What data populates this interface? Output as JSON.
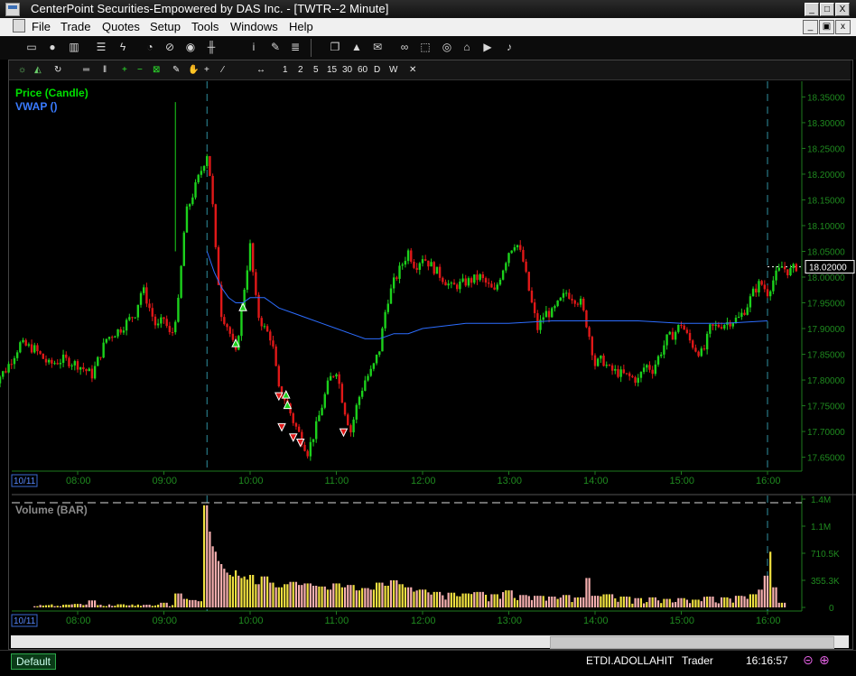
{
  "window": {
    "title": "CenterPoint Securities-Empowered by DAS Inc. - [TWTR--2 Minute]",
    "controls": [
      "_",
      "□",
      "X"
    ]
  },
  "menu": {
    "items": [
      "File",
      "Trade",
      "Quotes",
      "Setup",
      "Tools",
      "Windows",
      "Help"
    ],
    "mdi_controls": [
      "_",
      "▣",
      "x"
    ]
  },
  "toolbar": {
    "icons": [
      "window-icon",
      "person-icon",
      "chart-icon",
      "list-icon",
      "lightning-icon",
      "clock-icon",
      "link-icon",
      "eye-icon",
      "candles-icon",
      "info-icon",
      "edit-icon",
      "multi-window-icon",
      "alert-icon",
      "mail-icon",
      "binoculars-icon",
      "dotted-box-icon",
      "home-icon",
      "play-icon",
      "twitter-icon"
    ]
  },
  "chart_toolbar": {
    "timeframes": [
      "1",
      "2",
      "5",
      "15",
      "30",
      "60",
      "D",
      "W"
    ]
  },
  "chart_data": {
    "type": "candlestick",
    "symbol": "TWTR",
    "interval": "2 Minute",
    "indicators": [
      {
        "name": "Price (Candle)",
        "color": "#00e000"
      },
      {
        "name": "VWAP ()",
        "color": "#2c6dff"
      }
    ],
    "price_axis": {
      "ticks": [
        "18.35000",
        "18.30000",
        "18.25000",
        "18.20000",
        "18.15000",
        "18.10000",
        "18.05000",
        "18.00000",
        "17.95000",
        "17.90000",
        "17.85000",
        "17.80000",
        "17.75000",
        "17.70000",
        "17.65000"
      ],
      "ylim": [
        17.63,
        18.37
      ],
      "last_price": "18.02000"
    },
    "time_axis": {
      "date": "10/11",
      "ticks": [
        "08:00",
        "09:00",
        "10:00",
        "11:00",
        "12:00",
        "13:00",
        "14:00",
        "15:00",
        "16:00"
      ]
    },
    "price_path": [
      [
        "07:00",
        17.79
      ],
      [
        "07:10",
        17.82
      ],
      [
        "07:20",
        17.87
      ],
      [
        "07:30",
        17.86
      ],
      [
        "07:40",
        17.83
      ],
      [
        "07:50",
        17.84
      ],
      [
        "08:00",
        17.83
      ],
      [
        "08:10",
        17.81
      ],
      [
        "08:20",
        17.88
      ],
      [
        "08:30",
        17.9
      ],
      [
        "08:40",
        17.93
      ],
      [
        "08:45",
        17.98
      ],
      [
        "08:50",
        17.94
      ],
      [
        "08:55",
        17.9
      ],
      [
        "09:00",
        17.92
      ],
      [
        "09:05",
        17.88
      ],
      [
        "09:10",
        17.95
      ],
      [
        "09:15",
        18.12
      ],
      [
        "09:20",
        18.16
      ],
      [
        "09:25",
        18.2
      ],
      [
        "09:30",
        18.24
      ],
      [
        "09:33",
        18.18
      ],
      [
        "09:36",
        18.05
      ],
      [
        "09:40",
        17.93
      ],
      [
        "09:45",
        17.9
      ],
      [
        "09:50",
        17.85
      ],
      [
        "09:55",
        17.96
      ],
      [
        "10:00",
        18.06
      ],
      [
        "10:05",
        17.93
      ],
      [
        "10:10",
        17.9
      ],
      [
        "10:15",
        17.88
      ],
      [
        "10:20",
        17.78
      ],
      [
        "10:25",
        17.76
      ],
      [
        "10:30",
        17.72
      ],
      [
        "10:35",
        17.69
      ],
      [
        "10:40",
        17.66
      ],
      [
        "10:45",
        17.7
      ],
      [
        "10:50",
        17.75
      ],
      [
        "10:55",
        17.8
      ],
      [
        "11:00",
        17.82
      ],
      [
        "11:05",
        17.75
      ],
      [
        "11:10",
        17.7
      ],
      [
        "11:15",
        17.76
      ],
      [
        "11:20",
        17.8
      ],
      [
        "11:25",
        17.82
      ],
      [
        "11:30",
        17.86
      ],
      [
        "11:35",
        17.95
      ],
      [
        "11:40",
        17.99
      ],
      [
        "11:45",
        18.02
      ],
      [
        "11:50",
        18.05
      ],
      [
        "11:55",
        18.02
      ],
      [
        "12:00",
        18.04
      ],
      [
        "12:10",
        18.01
      ],
      [
        "12:20",
        17.98
      ],
      [
        "12:30",
        17.99
      ],
      [
        "12:40",
        18.0
      ],
      [
        "12:50",
        17.97
      ],
      [
        "13:00",
        18.05
      ],
      [
        "13:05",
        18.07
      ],
      [
        "13:10",
        18.03
      ],
      [
        "13:15",
        17.96
      ],
      [
        "13:20",
        17.9
      ],
      [
        "13:25",
        17.93
      ],
      [
        "13:30",
        17.93
      ],
      [
        "13:40",
        17.97
      ],
      [
        "13:50",
        17.95
      ],
      [
        "13:55",
        17.9
      ],
      [
        "14:00",
        17.83
      ],
      [
        "14:05",
        17.84
      ],
      [
        "14:10",
        17.82
      ],
      [
        "14:20",
        17.81
      ],
      [
        "14:30",
        17.8
      ],
      [
        "14:35",
        17.83
      ],
      [
        "14:40",
        17.82
      ],
      [
        "14:50",
        17.88
      ],
      [
        "14:55",
        17.89
      ],
      [
        "15:00",
        17.91
      ],
      [
        "15:05",
        17.88
      ],
      [
        "15:10",
        17.86
      ],
      [
        "15:15",
        17.85
      ],
      [
        "15:20",
        17.9
      ],
      [
        "15:30",
        17.91
      ],
      [
        "15:40",
        17.92
      ],
      [
        "15:45",
        17.94
      ],
      [
        "15:50",
        17.97
      ],
      [
        "15:55",
        17.99
      ],
      [
        "16:00",
        17.97
      ],
      [
        "16:05",
        18.0
      ],
      [
        "16:10",
        18.02
      ],
      [
        "16:15",
        18.01
      ],
      [
        "16:20",
        18.02
      ]
    ],
    "vwap_path": [
      [
        "09:30",
        18.05
      ],
      [
        "09:35",
        18.01
      ],
      [
        "09:40",
        17.98
      ],
      [
        "09:45",
        17.96
      ],
      [
        "09:50",
        17.95
      ],
      [
        "09:55",
        17.95
      ],
      [
        "10:00",
        17.96
      ],
      [
        "10:05",
        17.96
      ],
      [
        "10:10",
        17.96
      ],
      [
        "10:15",
        17.95
      ],
      [
        "10:20",
        17.94
      ],
      [
        "10:30",
        17.93
      ],
      [
        "10:40",
        17.92
      ],
      [
        "10:50",
        17.91
      ],
      [
        "11:00",
        17.9
      ],
      [
        "11:10",
        17.89
      ],
      [
        "11:20",
        17.88
      ],
      [
        "11:30",
        17.88
      ],
      [
        "11:40",
        17.89
      ],
      [
        "11:50",
        17.89
      ],
      [
        "12:00",
        17.9
      ],
      [
        "12:30",
        17.91
      ],
      [
        "13:00",
        17.91
      ],
      [
        "13:30",
        17.915
      ],
      [
        "14:00",
        17.915
      ],
      [
        "14:30",
        17.915
      ],
      [
        "15:00",
        17.91
      ],
      [
        "15:30",
        17.91
      ],
      [
        "16:00",
        17.915
      ]
    ],
    "signals": [
      {
        "time": "09:50",
        "price": 17.87,
        "dir": "buy"
      },
      {
        "time": "09:55",
        "price": 17.94,
        "dir": "buy"
      },
      {
        "time": "10:25",
        "price": 17.77,
        "dir": "buy"
      },
      {
        "time": "10:26",
        "price": 17.75,
        "dir": "buy"
      },
      {
        "time": "10:20",
        "price": 17.77,
        "dir": "sell"
      },
      {
        "time": "10:22",
        "price": 17.71,
        "dir": "sell"
      },
      {
        "time": "10:30",
        "price": 17.69,
        "dir": "sell"
      },
      {
        "time": "10:35",
        "price": 17.68,
        "dir": "sell"
      },
      {
        "time": "11:05",
        "price": 17.7,
        "dir": "sell"
      }
    ],
    "volume": {
      "title": "Volume (BAR)",
      "axis_ticks": [
        "1.4M",
        "1.1M",
        "710.5K",
        "355.3K",
        "0"
      ],
      "ylim": [
        0,
        1400000
      ],
      "bars": [
        [
          "08:00",
          45000
        ],
        [
          "08:10",
          90000
        ],
        [
          "08:30",
          40000
        ],
        [
          "09:00",
          60000
        ],
        [
          "09:10",
          180000
        ],
        [
          "09:15",
          110000
        ],
        [
          "09:20",
          95000
        ],
        [
          "09:25",
          80000
        ],
        [
          "09:30",
          1320000
        ],
        [
          "09:32",
          980000
        ],
        [
          "09:34",
          790000
        ],
        [
          "09:36",
          720000
        ],
        [
          "09:38",
          600000
        ],
        [
          "09:40",
          560000
        ],
        [
          "09:42",
          500000
        ],
        [
          "09:44",
          450000
        ],
        [
          "09:46",
          420000
        ],
        [
          "09:48",
          400000
        ],
        [
          "09:50",
          480000
        ],
        [
          "09:52",
          410000
        ],
        [
          "09:54",
          380000
        ],
        [
          "09:56",
          400000
        ],
        [
          "09:58",
          360000
        ],
        [
          "10:00",
          420000
        ],
        [
          "10:05",
          300000
        ],
        [
          "10:10",
          400000
        ],
        [
          "10:15",
          320000
        ],
        [
          "10:20",
          260000
        ],
        [
          "10:25",
          300000
        ],
        [
          "10:30",
          330000
        ],
        [
          "10:35",
          290000
        ],
        [
          "10:40",
          310000
        ],
        [
          "10:45",
          280000
        ],
        [
          "10:50",
          270000
        ],
        [
          "10:55",
          230000
        ],
        [
          "11:00",
          310000
        ],
        [
          "11:05",
          260000
        ],
        [
          "11:10",
          290000
        ],
        [
          "11:15",
          220000
        ],
        [
          "11:20",
          250000
        ],
        [
          "11:25",
          230000
        ],
        [
          "11:30",
          320000
        ],
        [
          "11:35",
          280000
        ],
        [
          "11:40",
          350000
        ],
        [
          "11:45",
          300000
        ],
        [
          "11:50",
          260000
        ],
        [
          "12:00",
          230000
        ],
        [
          "12:10",
          200000
        ],
        [
          "12:20",
          190000
        ],
        [
          "12:30",
          180000
        ],
        [
          "12:40",
          200000
        ],
        [
          "12:50",
          170000
        ],
        [
          "13:00",
          220000
        ],
        [
          "13:10",
          160000
        ],
        [
          "13:20",
          150000
        ],
        [
          "13:30",
          140000
        ],
        [
          "13:40",
          160000
        ],
        [
          "13:50",
          130000
        ],
        [
          "13:55",
          380000
        ],
        [
          "14:00",
          150000
        ],
        [
          "14:10",
          170000
        ],
        [
          "14:20",
          140000
        ],
        [
          "14:30",
          120000
        ],
        [
          "14:40",
          130000
        ],
        [
          "14:50",
          110000
        ],
        [
          "15:00",
          120000
        ],
        [
          "15:10",
          100000
        ],
        [
          "15:20",
          140000
        ],
        [
          "15:30",
          130000
        ],
        [
          "15:40",
          150000
        ],
        [
          "15:50",
          170000
        ],
        [
          "15:55",
          230000
        ],
        [
          "16:00",
          410000
        ],
        [
          "16:02",
          720000
        ],
        [
          "16:04",
          260000
        ],
        [
          "16:10",
          60000
        ]
      ]
    }
  },
  "status": {
    "tab": "Default",
    "account": "ETDI.ADOLLAHIT",
    "role": "Trader",
    "clock": "16:16:57"
  }
}
